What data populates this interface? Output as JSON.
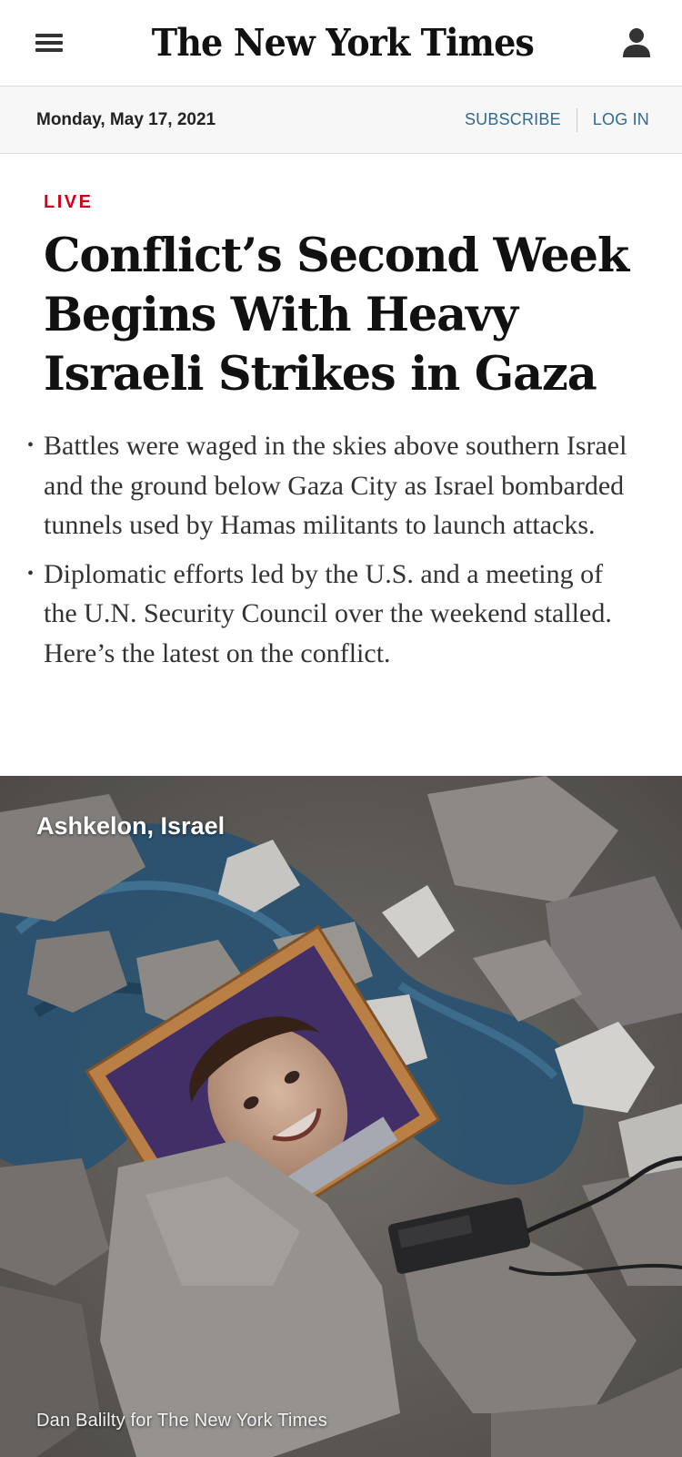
{
  "header": {
    "logo_text": "The New York Times",
    "menu_icon": "hamburger-menu-icon",
    "account_icon": "user-account-icon"
  },
  "subbar": {
    "date": "Monday, May 17, 2021",
    "subscribe_label": "SUBSCRIBE",
    "login_label": "LOG IN"
  },
  "article": {
    "label": "LIVE",
    "headline": "Conflict’s Second Week Begins With Heavy Israeli Strikes in Gaza",
    "summary": [
      "Battles were waged in the skies above southern Israel and the ground below Gaza City as Israel bombarded tunnels used by Hamas militants to launch attacks.",
      "Diplomatic efforts led by the U.S. and a meeting of the U.N. Security Council over the weekend stalled. Here’s the latest on the conflict."
    ]
  },
  "photo": {
    "location": "Ashkelon, Israel",
    "credit": "Dan Balilty for The New York Times"
  },
  "colors": {
    "live_red": "#d0021b",
    "link_blue": "#326891",
    "subbar_bg": "#f7f7f7"
  }
}
